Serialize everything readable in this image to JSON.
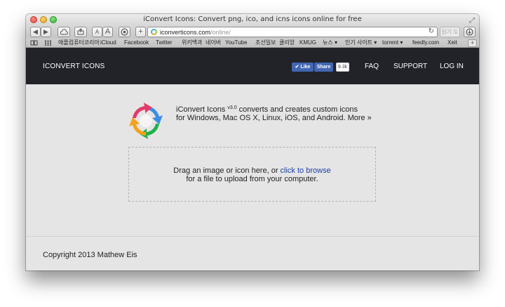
{
  "browser": {
    "window_title": "iConvert Icons: Convert png, ico, and icns icons online for free",
    "url_domain": "iconverticons.com",
    "url_path": "/online/",
    "reader_label": "읽기 도구",
    "bookmarks": [
      "애플컴퓨터코리아",
      "iCloud",
      "Facebook",
      "Twitter",
      "위키백과",
      "네이버",
      "YouTube",
      "조선일보",
      "클리앙",
      "KMUG",
      "뉴스 ▾",
      "인기 사이트 ▾",
      "torrent ▾",
      "feedly.com",
      "Xeit"
    ]
  },
  "nav": {
    "brand": "ICONVERT ICONS",
    "fb_like": "Like",
    "fb_share": "Share",
    "fb_count": "9.3k",
    "links": [
      "FAQ",
      "SUPPORT",
      "LOG IN"
    ]
  },
  "main": {
    "intro_name": "iConvert Icons",
    "intro_version": "v3.0",
    "intro_line1_rest": " converts and creates custom icons",
    "intro_line2": "for Windows, Mac OS X, Linux, iOS, and Android.",
    "more_link": "More »",
    "drop_text_before": "Drag an image or icon here, or ",
    "browse_link": "click to browse",
    "drop_text_after": "for a file to upload from your computer."
  },
  "footer": {
    "copyright": "Copyright 2013 Mathew Eis"
  },
  "colors": {
    "navbar_bg": "#212329",
    "link_blue": "#1a3fa8",
    "facebook_blue": "#4267b2"
  },
  "icons": [
    "back-icon",
    "forward-icon",
    "cloud-icon",
    "share-icon",
    "text-smaller-icon",
    "text-larger-icon",
    "privacy-icon",
    "new-tab-icon",
    "reload-icon",
    "download-icon",
    "reading-list-icon",
    "top-sites-icon",
    "app-logo-icon"
  ]
}
